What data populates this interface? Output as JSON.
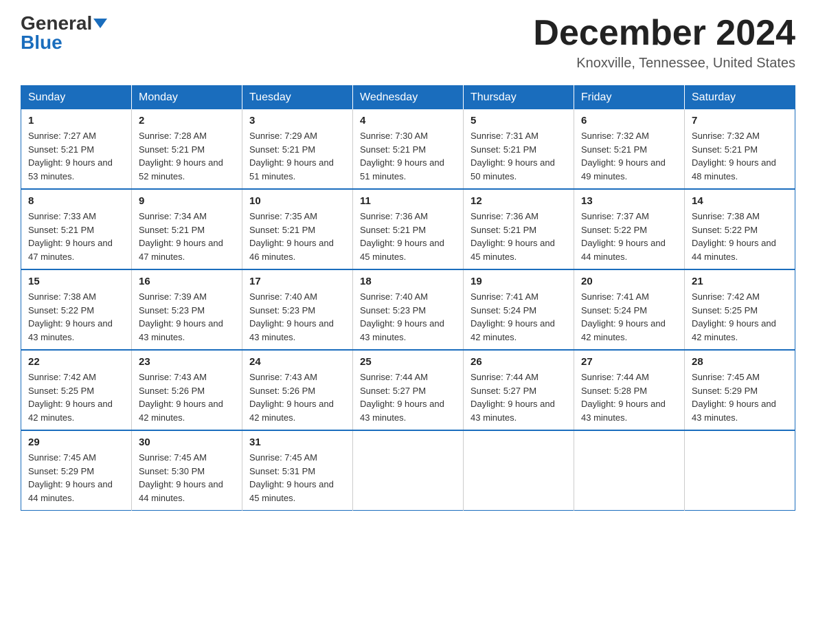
{
  "logo": {
    "general": "General",
    "blue": "Blue"
  },
  "title": "December 2024",
  "location": "Knoxville, Tennessee, United States",
  "weekdays": [
    "Sunday",
    "Monday",
    "Tuesday",
    "Wednesday",
    "Thursday",
    "Friday",
    "Saturday"
  ],
  "weeks": [
    [
      {
        "day": "1",
        "sunrise": "7:27 AM",
        "sunset": "5:21 PM",
        "daylight": "9 hours and 53 minutes."
      },
      {
        "day": "2",
        "sunrise": "7:28 AM",
        "sunset": "5:21 PM",
        "daylight": "9 hours and 52 minutes."
      },
      {
        "day": "3",
        "sunrise": "7:29 AM",
        "sunset": "5:21 PM",
        "daylight": "9 hours and 51 minutes."
      },
      {
        "day": "4",
        "sunrise": "7:30 AM",
        "sunset": "5:21 PM",
        "daylight": "9 hours and 51 minutes."
      },
      {
        "day": "5",
        "sunrise": "7:31 AM",
        "sunset": "5:21 PM",
        "daylight": "9 hours and 50 minutes."
      },
      {
        "day": "6",
        "sunrise": "7:32 AM",
        "sunset": "5:21 PM",
        "daylight": "9 hours and 49 minutes."
      },
      {
        "day": "7",
        "sunrise": "7:32 AM",
        "sunset": "5:21 PM",
        "daylight": "9 hours and 48 minutes."
      }
    ],
    [
      {
        "day": "8",
        "sunrise": "7:33 AM",
        "sunset": "5:21 PM",
        "daylight": "9 hours and 47 minutes."
      },
      {
        "day": "9",
        "sunrise": "7:34 AM",
        "sunset": "5:21 PM",
        "daylight": "9 hours and 47 minutes."
      },
      {
        "day": "10",
        "sunrise": "7:35 AM",
        "sunset": "5:21 PM",
        "daylight": "9 hours and 46 minutes."
      },
      {
        "day": "11",
        "sunrise": "7:36 AM",
        "sunset": "5:21 PM",
        "daylight": "9 hours and 45 minutes."
      },
      {
        "day": "12",
        "sunrise": "7:36 AM",
        "sunset": "5:21 PM",
        "daylight": "9 hours and 45 minutes."
      },
      {
        "day": "13",
        "sunrise": "7:37 AM",
        "sunset": "5:22 PM",
        "daylight": "9 hours and 44 minutes."
      },
      {
        "day": "14",
        "sunrise": "7:38 AM",
        "sunset": "5:22 PM",
        "daylight": "9 hours and 44 minutes."
      }
    ],
    [
      {
        "day": "15",
        "sunrise": "7:38 AM",
        "sunset": "5:22 PM",
        "daylight": "9 hours and 43 minutes."
      },
      {
        "day": "16",
        "sunrise": "7:39 AM",
        "sunset": "5:23 PM",
        "daylight": "9 hours and 43 minutes."
      },
      {
        "day": "17",
        "sunrise": "7:40 AM",
        "sunset": "5:23 PM",
        "daylight": "9 hours and 43 minutes."
      },
      {
        "day": "18",
        "sunrise": "7:40 AM",
        "sunset": "5:23 PM",
        "daylight": "9 hours and 43 minutes."
      },
      {
        "day": "19",
        "sunrise": "7:41 AM",
        "sunset": "5:24 PM",
        "daylight": "9 hours and 42 minutes."
      },
      {
        "day": "20",
        "sunrise": "7:41 AM",
        "sunset": "5:24 PM",
        "daylight": "9 hours and 42 minutes."
      },
      {
        "day": "21",
        "sunrise": "7:42 AM",
        "sunset": "5:25 PM",
        "daylight": "9 hours and 42 minutes."
      }
    ],
    [
      {
        "day": "22",
        "sunrise": "7:42 AM",
        "sunset": "5:25 PM",
        "daylight": "9 hours and 42 minutes."
      },
      {
        "day": "23",
        "sunrise": "7:43 AM",
        "sunset": "5:26 PM",
        "daylight": "9 hours and 42 minutes."
      },
      {
        "day": "24",
        "sunrise": "7:43 AM",
        "sunset": "5:26 PM",
        "daylight": "9 hours and 42 minutes."
      },
      {
        "day": "25",
        "sunrise": "7:44 AM",
        "sunset": "5:27 PM",
        "daylight": "9 hours and 43 minutes."
      },
      {
        "day": "26",
        "sunrise": "7:44 AM",
        "sunset": "5:27 PM",
        "daylight": "9 hours and 43 minutes."
      },
      {
        "day": "27",
        "sunrise": "7:44 AM",
        "sunset": "5:28 PM",
        "daylight": "9 hours and 43 minutes."
      },
      {
        "day": "28",
        "sunrise": "7:45 AM",
        "sunset": "5:29 PM",
        "daylight": "9 hours and 43 minutes."
      }
    ],
    [
      {
        "day": "29",
        "sunrise": "7:45 AM",
        "sunset": "5:29 PM",
        "daylight": "9 hours and 44 minutes."
      },
      {
        "day": "30",
        "sunrise": "7:45 AM",
        "sunset": "5:30 PM",
        "daylight": "9 hours and 44 minutes."
      },
      {
        "day": "31",
        "sunrise": "7:45 AM",
        "sunset": "5:31 PM",
        "daylight": "9 hours and 45 minutes."
      },
      null,
      null,
      null,
      null
    ]
  ]
}
